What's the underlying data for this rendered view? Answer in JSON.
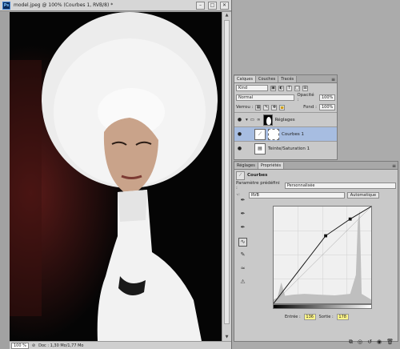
{
  "document": {
    "title": "model.jpeg @ 100% (Courbes 1, RVB/8) *",
    "ps_logo": "Ps",
    "min_btn": "–",
    "max_btn": "□",
    "close_btn": "✕",
    "zoom": "100 %",
    "doc_info": "Doc : 1,30 Mo/1,77 Mo"
  },
  "layers_panel": {
    "tabs": [
      "Calques",
      "Couches",
      "Tracés"
    ],
    "kind_select": "Kind",
    "blend_mode": "Normal",
    "opacity_label": "Opacité :",
    "opacity_value": "100%",
    "lock_label": "Verrou :",
    "fill_label": "Fond :",
    "fill_value": "100%",
    "layers": [
      {
        "name": "Réglages",
        "type": "group"
      },
      {
        "name": "Courbes 1",
        "type": "curves"
      },
      {
        "name": "Teinte/Saturation 1",
        "type": "hue"
      }
    ]
  },
  "properties_panel": {
    "tabs": [
      "Réglages",
      "Propriétés"
    ],
    "panel_title": "Courbes",
    "preset_label": "Paramètre prédéfini :",
    "preset_value": "Personnalisée",
    "channel_value": "RVB",
    "auto_button": "Automatique",
    "input_label": "Entrée :",
    "input_value": "136",
    "output_label": "Sortie :",
    "output_value": "178"
  },
  "curve": {
    "points": [
      [
        0,
        0
      ],
      [
        136,
        178
      ],
      [
        200,
        222
      ],
      [
        255,
        255
      ]
    ]
  },
  "colors": {
    "selected_layer": "#a7bde1",
    "io_highlight": "#fff58a"
  }
}
